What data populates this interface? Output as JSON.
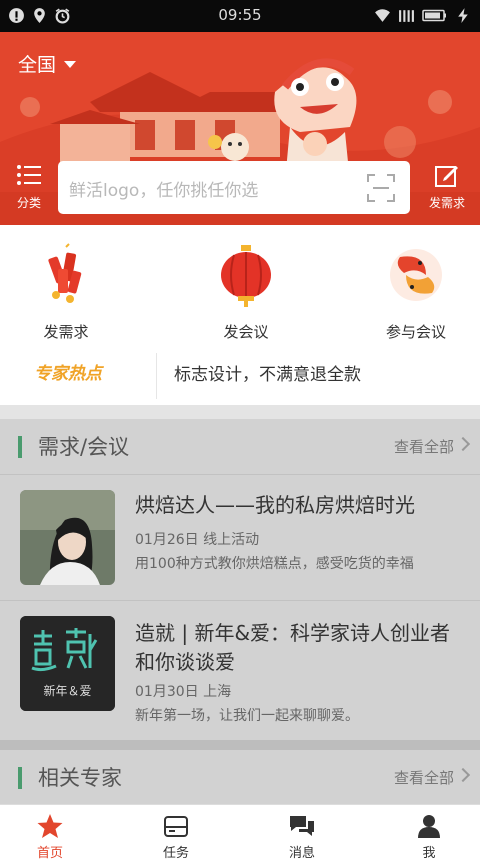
{
  "status_bar": {
    "time": "09:55"
  },
  "header": {
    "city": "全国",
    "menu_label": "分类",
    "publish_label": "发需求",
    "search_placeholder": "鲜活logo，任你挑任你选"
  },
  "actions": [
    {
      "label": "发需求",
      "icon": "firecracker-icon"
    },
    {
      "label": "发会议",
      "icon": "lantern-icon"
    },
    {
      "label": "参与会议",
      "icon": "koi-fish-icon"
    }
  ],
  "hot": {
    "tag": "专家热点",
    "text": "标志设计，不满意退全款"
  },
  "demand_section": {
    "title": "需求/会议",
    "more": "查看全部",
    "items": [
      {
        "title": "烘焙达人——我的私房烘焙时光",
        "meta": "01月26日  线上活动",
        "desc": "用100种方式教你烘焙糕点，感受吃货的幸福"
      },
      {
        "title": "造就 | 新年&爱：科学家诗人创业者和你谈谈爱",
        "meta": "01月30日  上海",
        "desc": "新年第一场，让我们一起来聊聊爱。",
        "thumb_text": "新年＆爱"
      }
    ]
  },
  "expert_section": {
    "title": "相关专家",
    "more": "查看全部"
  },
  "tabs": [
    {
      "label": "首页",
      "active": true
    },
    {
      "label": "任务",
      "active": false
    },
    {
      "label": "消息",
      "active": false
    },
    {
      "label": "我",
      "active": false
    }
  ],
  "colors": {
    "brand_red": "#e2462d",
    "hot_orange": "#f0a327",
    "section_green": "#4a9b6e"
  }
}
